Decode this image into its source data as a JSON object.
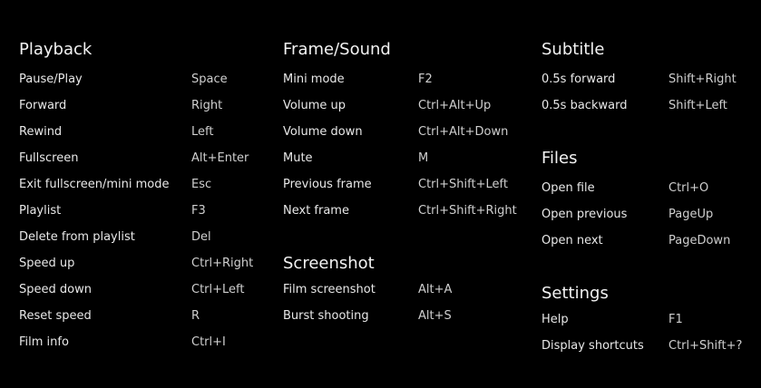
{
  "columns": [
    {
      "sections": [
        {
          "title": "Playback",
          "items": [
            {
              "action": "Pause/Play",
              "key": "Space"
            },
            {
              "action": "Forward",
              "key": "Right"
            },
            {
              "action": "Rewind",
              "key": "Left"
            },
            {
              "action": "Fullscreen",
              "key": "Alt+Enter"
            },
            {
              "action": "Exit fullscreen/mini mode",
              "key": "Esc"
            },
            {
              "action": "Playlist",
              "key": "F3"
            },
            {
              "action": "Delete from playlist",
              "key": "Del"
            },
            {
              "action": "Speed up",
              "key": "Ctrl+Right"
            },
            {
              "action": "Speed down",
              "key": "Ctrl+Left"
            },
            {
              "action": "Reset speed",
              "key": "R"
            },
            {
              "action": "Film info",
              "key": "Ctrl+I"
            }
          ]
        }
      ]
    },
    {
      "sections": [
        {
          "title": "Frame/Sound",
          "items": [
            {
              "action": "Mini mode",
              "key": "F2"
            },
            {
              "action": "Volume up",
              "key": "Ctrl+Alt+Up"
            },
            {
              "action": "Volume down",
              "key": "Ctrl+Alt+Down"
            },
            {
              "action": "Mute",
              "key": "M"
            },
            {
              "action": "Previous frame",
              "key": "Ctrl+Shift+Left"
            },
            {
              "action": "Next frame",
              "key": "Ctrl+Shift+Right"
            }
          ]
        },
        {
          "title": "Screenshot",
          "items": [
            {
              "action": "Film screenshot",
              "key": "Alt+A"
            },
            {
              "action": "Burst shooting",
              "key": "Alt+S"
            }
          ]
        }
      ]
    },
    {
      "sections": [
        {
          "title": "Subtitle",
          "items": [
            {
              "action": "0.5s forward",
              "key": "Shift+Right"
            },
            {
              "action": "0.5s backward",
              "key": "Shift+Left"
            }
          ]
        },
        {
          "title": "Files",
          "items": [
            {
              "action": "Open file",
              "key": "Ctrl+O"
            },
            {
              "action": "Open previous",
              "key": "PageUp"
            },
            {
              "action": "Open next",
              "key": "PageDown"
            }
          ]
        },
        {
          "title": "Settings",
          "items": [
            {
              "action": "Help",
              "key": "F1"
            },
            {
              "action": "Display shortcuts",
              "key": "Ctrl+Shift+?"
            }
          ]
        }
      ]
    }
  ]
}
